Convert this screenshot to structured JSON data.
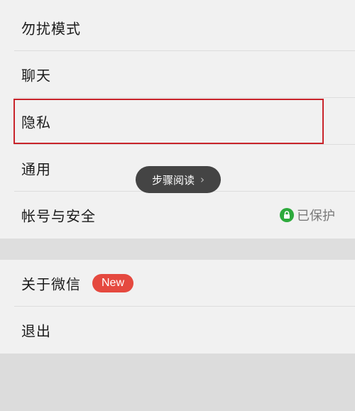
{
  "menu_group_1": {
    "items": [
      {
        "label": "勿扰模式"
      },
      {
        "label": "聊天"
      },
      {
        "label": "隐私"
      },
      {
        "label": "通用"
      },
      {
        "label": "帐号与安全",
        "status": "已保护"
      }
    ]
  },
  "menu_group_2": {
    "items": [
      {
        "label": "关于微信",
        "badge": "New"
      },
      {
        "label": "退出"
      }
    ]
  },
  "toast": {
    "label": "步骤阅读",
    "chevron": "›"
  },
  "colors": {
    "highlight_border": "#c9242b",
    "badge_bg": "#e5493f",
    "lock_icon": "#2daa3c",
    "toast_bg": "#444444"
  },
  "icons": {
    "protect": "lock-icon",
    "toast_arrow": "chevron-right-icon"
  }
}
